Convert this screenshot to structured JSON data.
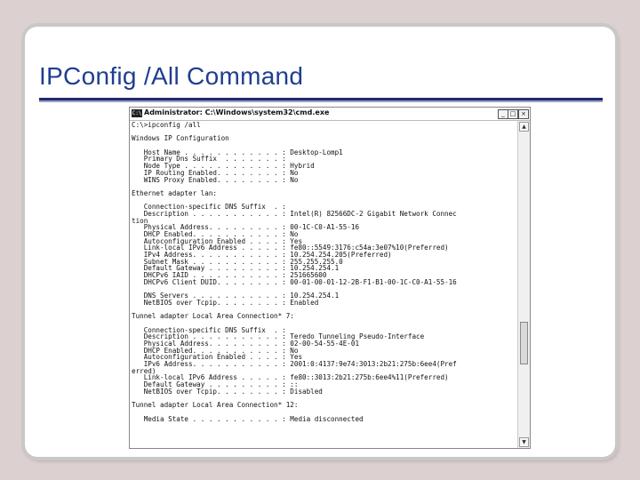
{
  "slide": {
    "title": "IPConfig /All Command"
  },
  "window": {
    "icon_label": "C:\\",
    "title": "Administrator: C:\\Windows\\system32\\cmd.exe",
    "minimize_label": "_",
    "maximize_label": "□",
    "close_label": "×",
    "scroll_up_label": "▲",
    "scroll_down_label": "▼"
  },
  "console": {
    "lines": [
      "C:\\>ipconfig /all",
      "",
      "Windows IP Configuration",
      "",
      "   Host Name . . . . . . . . . . . . : Desktop-Lomp1",
      "   Primary Dns Suffix  . . . . . . . :",
      "   Node Type . . . . . . . . . . . . : Hybrid",
      "   IP Routing Enabled. . . . . . . . : No",
      "   WINS Proxy Enabled. . . . . . . . : No",
      "",
      "Ethernet adapter lan:",
      "",
      "   Connection-specific DNS Suffix  . :",
      "   Description . . . . . . . . . . . : Intel(R) 82566DC-2 Gigabit Network Connec",
      "tion",
      "   Physical Address. . . . . . . . . : 00-1C-C0-A1-55-16",
      "   DHCP Enabled. . . . . . . . . . . : No",
      "   Autoconfiguration Enabled . . . . : Yes",
      "   Link-local IPv6 Address . . . . . : fe80::5549:3176:c54a:3e07%10(Preferred)",
      "   IPv4 Address. . . . . . . . . . . : 10.254.254.205(Preferred)",
      "   Subnet Mask . . . . . . . . . . . : 255.255.255.0",
      "   Default Gateway . . . . . . . . . : 10.254.254.1",
      "   DHCPv6 IAID . . . . . . . . . . . : 251665600",
      "   DHCPv6 Client DUID. . . . . . . . : 00-01-00-01-12-2B-F1-B1-00-1C-C0-A1-55-16",
      "",
      "   DNS Servers . . . . . . . . . . . : 10.254.254.1",
      "   NetBIOS over Tcpip. . . . . . . . : Enabled",
      "",
      "Tunnel adapter Local Area Connection* 7:",
      "",
      "   Connection-specific DNS Suffix  . :",
      "   Description . . . . . . . . . . . : Teredo Tunneling Pseudo-Interface",
      "   Physical Address. . . . . . . . . : 02-00-54-55-4E-01",
      "   DHCP Enabled. . . . . . . . . . . : No",
      "   Autoconfiguration Enabled . . . . : Yes",
      "   IPv6 Address. . . . . . . . . . . : 2001:0:4137:9e74:3013:2b21:275b:6ee4(Pref",
      "erred)",
      "   Link-local IPv6 Address . . . . . : fe80::3013:2b21:275b:6ee4%11(Preferred)",
      "   Default Gateway . . . . . . . . . : ::",
      "   NetBIOS over Tcpip. . . . . . . . : Disabled",
      "",
      "Tunnel adapter Local Area Connection* 12:",
      "",
      "   Media State . . . . . . . . . . . : Media disconnected"
    ]
  }
}
